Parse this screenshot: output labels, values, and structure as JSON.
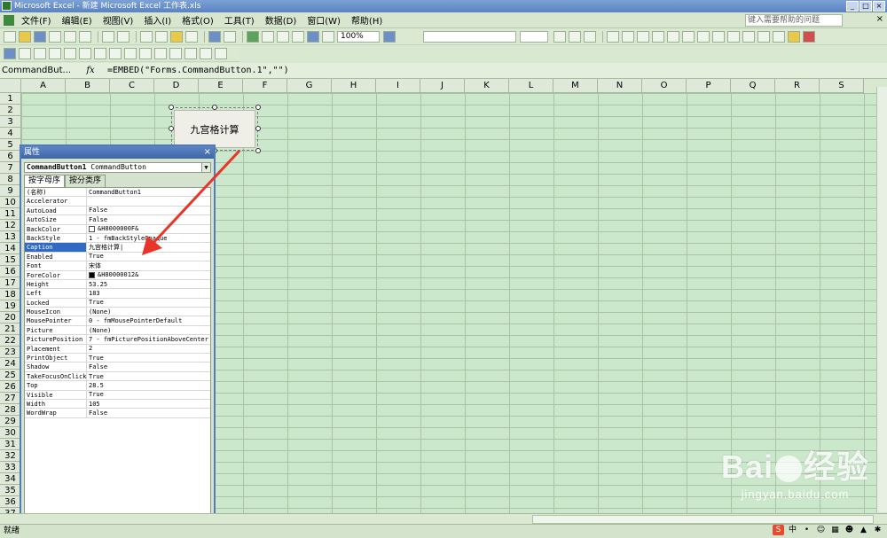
{
  "window": {
    "title": "Microsoft Excel - 新建 Microsoft Excel 工作表.xls",
    "buttons": [
      "_",
      "□",
      "×"
    ]
  },
  "menu": {
    "items": [
      "文件(F)",
      "编辑(E)",
      "视图(V)",
      "插入(I)",
      "格式(O)",
      "工具(T)",
      "数据(D)",
      "窗口(W)",
      "帮助(H)"
    ],
    "help_placeholder": "键入需要帮助的问题",
    "close": "×"
  },
  "toolbar": {
    "zoom": "100%"
  },
  "formula_bar": {
    "name_box": "CommandBut...",
    "fx": "fx",
    "formula": "=EMBED(\"Forms.CommandButton.1\",\"\")"
  },
  "sheet": {
    "columns": [
      "A",
      "B",
      "C",
      "D",
      "E",
      "F",
      "G",
      "H",
      "I",
      "J",
      "K",
      "L",
      "M",
      "N",
      "O",
      "P",
      "Q",
      "R",
      "S"
    ],
    "rows": [
      "1",
      "2",
      "3",
      "4",
      "5",
      "6",
      "7",
      "8",
      "9",
      "10",
      "11",
      "12",
      "13",
      "14",
      "15",
      "16",
      "17",
      "18",
      "19",
      "20",
      "21",
      "22",
      "23",
      "24",
      "25",
      "26",
      "27",
      "28",
      "29",
      "30",
      "31",
      "32",
      "33",
      "34",
      "35",
      "36",
      "37"
    ]
  },
  "command_button": {
    "caption": "九宫格计算"
  },
  "properties_window": {
    "title": "属性",
    "close": "×",
    "object_name": "CommandButton1",
    "object_type": "CommandButton",
    "tabs": [
      "按字母序",
      "按分类序"
    ],
    "selected_property": "Caption",
    "properties": [
      {
        "name": "(名称)",
        "value": "CommandButton1"
      },
      {
        "name": "Accelerator",
        "value": ""
      },
      {
        "name": "AutoLoad",
        "value": "False"
      },
      {
        "name": "AutoSize",
        "value": "False"
      },
      {
        "name": "BackColor",
        "value": "&H8000000F&",
        "swatch": "#ffffff"
      },
      {
        "name": "BackStyle",
        "value": "1 - fmBackStyleOpaque"
      },
      {
        "name": "Caption",
        "value": "九宫格计算|"
      },
      {
        "name": "Enabled",
        "value": "True"
      },
      {
        "name": "Font",
        "value": "宋体"
      },
      {
        "name": "ForeColor",
        "value": "&H80000012&",
        "swatch": "#000000"
      },
      {
        "name": "Height",
        "value": "53.25"
      },
      {
        "name": "Left",
        "value": "183"
      },
      {
        "name": "Locked",
        "value": "True"
      },
      {
        "name": "MouseIcon",
        "value": "(None)"
      },
      {
        "name": "MousePointer",
        "value": "0 - fmMousePointerDefault"
      },
      {
        "name": "Picture",
        "value": "(None)"
      },
      {
        "name": "PicturePosition",
        "value": "7 - fmPicturePositionAboveCenter"
      },
      {
        "name": "Placement",
        "value": "2"
      },
      {
        "name": "PrintObject",
        "value": "True"
      },
      {
        "name": "Shadow",
        "value": "False"
      },
      {
        "name": "TakeFocusOnClick",
        "value": "True"
      },
      {
        "name": "Top",
        "value": "28.5"
      },
      {
        "name": "Visible",
        "value": "True"
      },
      {
        "name": "Width",
        "value": "105"
      },
      {
        "name": "WordWrap",
        "value": "False"
      }
    ]
  },
  "status_bar": {
    "text": "就绪"
  },
  "watermark": {
    "logo_left": "Bai",
    "logo_right": "经验",
    "url": "jingyan.baidu.com"
  },
  "colors": {
    "cell_bg": "#cce8cc",
    "arrow": "#e8352a",
    "selection": "#316ac5"
  }
}
